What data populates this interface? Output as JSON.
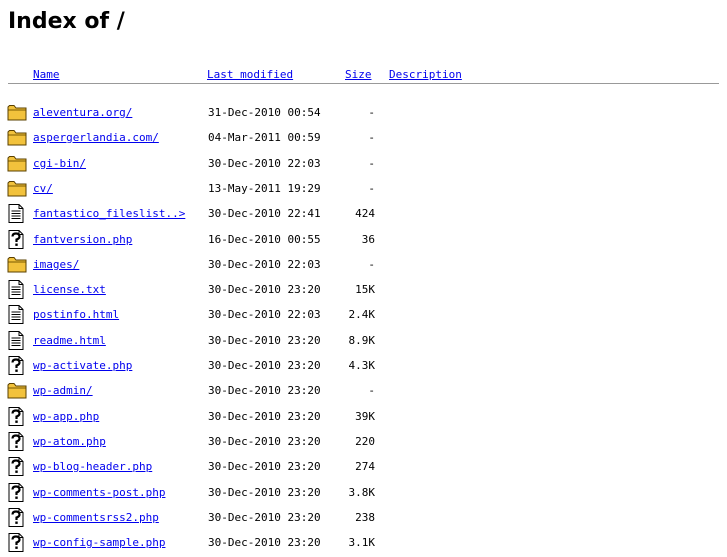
{
  "title": "Index of /",
  "columns": {
    "name": "Name",
    "last_modified": "Last modified",
    "size": "Size",
    "description": "Description"
  },
  "rows": [
    {
      "icon": "folder-icon",
      "name": "aleventura.org/",
      "date": "31-Dec-2010 00:54",
      "size": "-"
    },
    {
      "icon": "folder-icon",
      "name": "aspergerlandia.com/",
      "date": "04-Mar-2011 00:59",
      "size": "-"
    },
    {
      "icon": "folder-icon",
      "name": "cgi-bin/",
      "date": "30-Dec-2010 22:03",
      "size": "-"
    },
    {
      "icon": "folder-icon",
      "name": "cv/",
      "date": "13-May-2011 19:29",
      "size": "-"
    },
    {
      "icon": "text-file-icon",
      "name": "fantastico_fileslist..>",
      "date": "30-Dec-2010 22:41",
      "size": "424"
    },
    {
      "icon": "unknown-file-icon",
      "name": "fantversion.php",
      "date": "16-Dec-2010 00:55",
      "size": "36"
    },
    {
      "icon": "folder-icon",
      "name": "images/",
      "date": "30-Dec-2010 22:03",
      "size": "-"
    },
    {
      "icon": "text-file-icon",
      "name": "license.txt",
      "date": "30-Dec-2010 23:20",
      "size": "15K"
    },
    {
      "icon": "text-file-icon",
      "name": "postinfo.html",
      "date": "30-Dec-2010 22:03",
      "size": "2.4K"
    },
    {
      "icon": "text-file-icon",
      "name": "readme.html",
      "date": "30-Dec-2010 23:20",
      "size": "8.9K"
    },
    {
      "icon": "unknown-file-icon",
      "name": "wp-activate.php",
      "date": "30-Dec-2010 23:20",
      "size": "4.3K"
    },
    {
      "icon": "folder-icon",
      "name": "wp-admin/",
      "date": "30-Dec-2010 23:20",
      "size": "-"
    },
    {
      "icon": "unknown-file-icon",
      "name": "wp-app.php",
      "date": "30-Dec-2010 23:20",
      "size": "39K"
    },
    {
      "icon": "unknown-file-icon",
      "name": "wp-atom.php",
      "date": "30-Dec-2010 23:20",
      "size": "220"
    },
    {
      "icon": "unknown-file-icon",
      "name": "wp-blog-header.php",
      "date": "30-Dec-2010 23:20",
      "size": "274"
    },
    {
      "icon": "unknown-file-icon",
      "name": "wp-comments-post.php",
      "date": "30-Dec-2010 23:20",
      "size": "3.8K"
    },
    {
      "icon": "unknown-file-icon",
      "name": "wp-commentsrss2.php",
      "date": "30-Dec-2010 23:20",
      "size": "238"
    },
    {
      "icon": "unknown-file-icon",
      "name": "wp-config-sample.php",
      "date": "30-Dec-2010 23:20",
      "size": "3.1K"
    }
  ]
}
